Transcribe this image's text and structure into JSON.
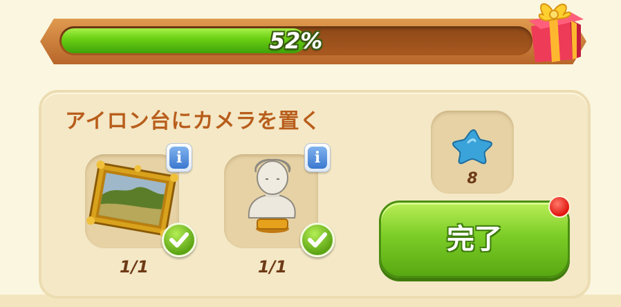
{
  "progress": {
    "percent": 52,
    "label": "52%"
  },
  "task": {
    "title": "アイロン台にカメラを置く",
    "items": [
      {
        "icon": "framed-painting-icon",
        "count": "1/1",
        "completed": true,
        "info_label": "i"
      },
      {
        "icon": "marble-bust-icon",
        "count": "1/1",
        "completed": true,
        "info_label": "i"
      }
    ],
    "reward": {
      "icon": "blue-star-icon",
      "amount": "8"
    },
    "done_button": {
      "label": "完了"
    }
  },
  "colors": {
    "progress_fill": "#6cd114",
    "title": "#b85e1c",
    "button": "#7ccd27",
    "notification": "#e0140e"
  }
}
